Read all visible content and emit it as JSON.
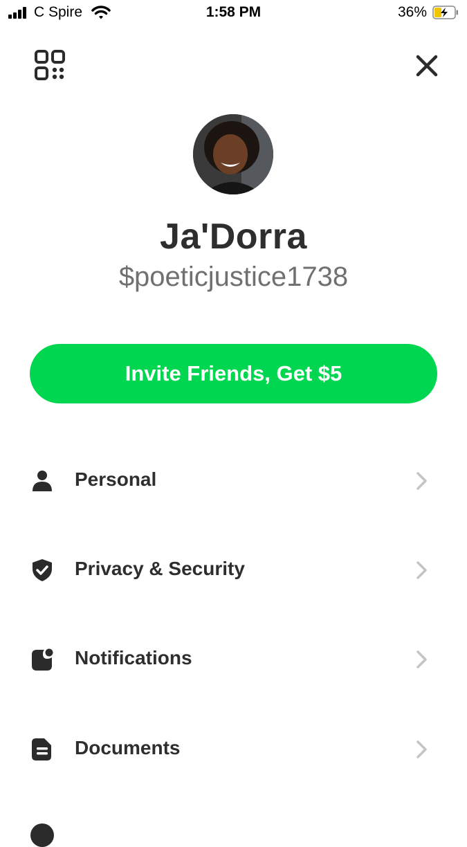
{
  "status_bar": {
    "carrier": "C Spire",
    "time": "1:58 PM",
    "battery_percent": "36%",
    "battery_level": 0.36
  },
  "header": {
    "left_icon": "qr-code-icon",
    "right_icon": "close-icon"
  },
  "profile": {
    "name": "Ja'Dorra",
    "cashtag": "$poeticjustice1738"
  },
  "invite_button": {
    "label": "Invite Friends, Get $5",
    "color": "#00d64f"
  },
  "menu": {
    "items": [
      {
        "label": "Personal",
        "icon": "person-icon"
      },
      {
        "label": "Privacy & Security",
        "icon": "shield-check-icon"
      },
      {
        "label": "Notifications",
        "icon": "notification-icon"
      },
      {
        "label": "Documents",
        "icon": "document-icon"
      }
    ]
  }
}
